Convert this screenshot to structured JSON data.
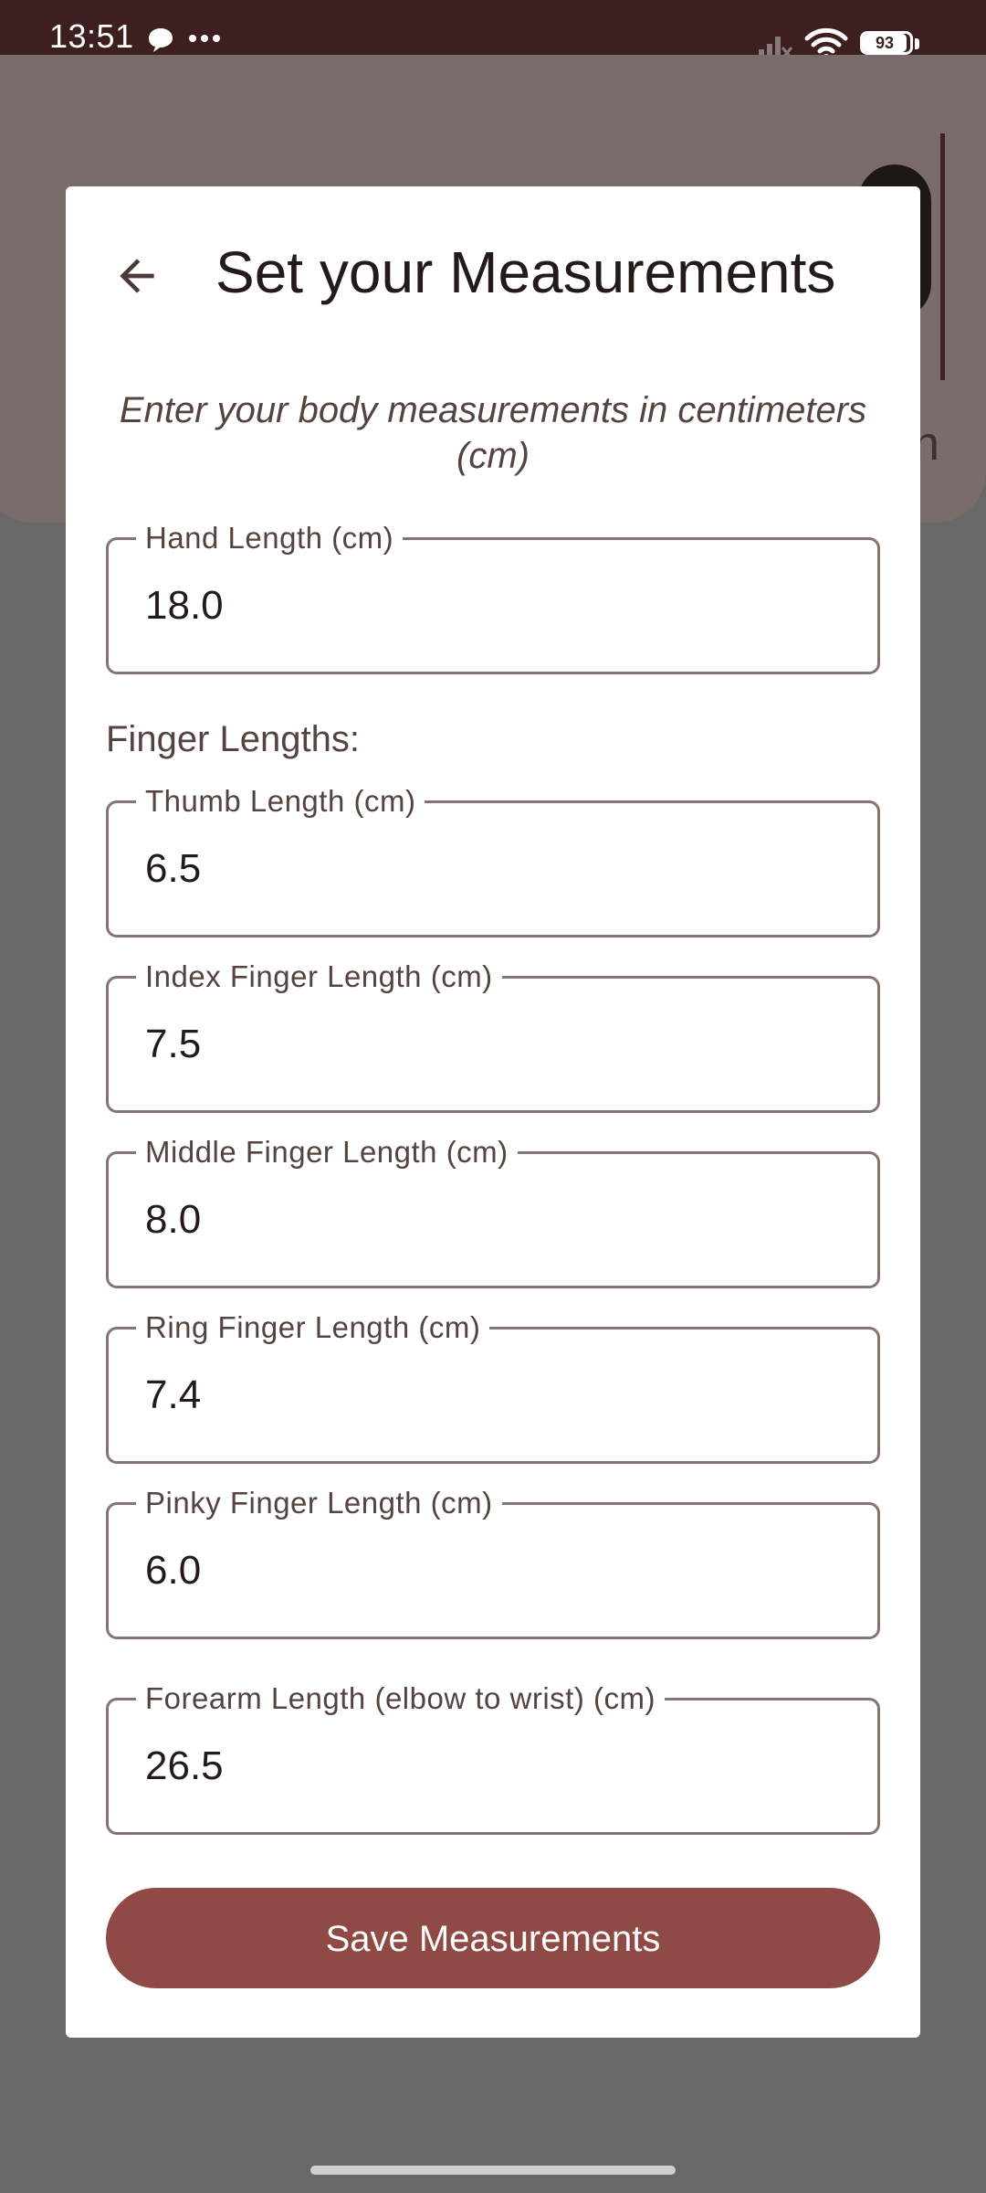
{
  "status_bar": {
    "time": "13:51",
    "battery_level": "93",
    "icons": [
      "chat-bubble-icon",
      "more-dots-icon",
      "signal-icon",
      "wifi-icon",
      "battery-icon"
    ]
  },
  "background": {
    "partial_text": "n"
  },
  "dialog": {
    "back_icon": "arrow-back-icon",
    "title": "Set your Measurements",
    "subtitle": "Enter your body measurements in centimeters (cm)",
    "hand_length": {
      "label": "Hand Length (cm)",
      "value": "18.0"
    },
    "finger_section_label": "Finger Lengths:",
    "fingers": [
      {
        "label": "Thumb Length (cm)",
        "value": "6.5"
      },
      {
        "label": "Index Finger Length (cm)",
        "value": "7.5"
      },
      {
        "label": "Middle Finger Length (cm)",
        "value": "8.0"
      },
      {
        "label": "Ring Finger Length (cm)",
        "value": "7.4"
      },
      {
        "label": "Pinky Finger Length (cm)",
        "value": "6.0"
      }
    ],
    "forearm_length": {
      "label": "Forearm Length (elbow to wrist) (cm)",
      "value": "26.5"
    },
    "save_button_label": "Save Measurements"
  },
  "colors": {
    "status_bar_bg": "#3c1f1e",
    "primary": "#8f4a45",
    "outline": "#857370",
    "on_surface": "#231a1a",
    "on_surface_variant": "#55433f",
    "scrim_bg": "#686868"
  }
}
